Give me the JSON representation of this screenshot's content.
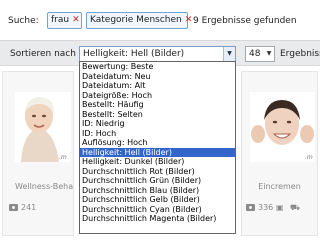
{
  "search": {
    "label": "Suche:",
    "tags": [
      {
        "text": "frau",
        "remove": "✕"
      },
      {
        "text": "Kategorie Menschen",
        "remove": "✕"
      }
    ],
    "result_count": "9 Ergebnisse gefunden"
  },
  "toolbar": {
    "sort_label": "Sortieren nach",
    "sort_value": "Helligkeit: Hell (Bilder)",
    "per_page_value": "48",
    "per_page_label": "Ergebnisse"
  },
  "sort_options": [
    "Bewertung: Beste",
    "Dateidatum: Neu",
    "Dateidatum: Alt",
    "Dateigröße: Hoch",
    "Bestellt: Häufig",
    "Bestellt: Selten",
    "ID: Niedrig",
    "ID: Hoch",
    "Auflösung: Hoch",
    "Helligkeit: Hell (Bilder)",
    "Helligkeit: Dunkel (Bilder)",
    "Durchschnittlich Rot (Bilder)",
    "Durchschnittlich Grün (Bilder)",
    "Durchschnittlich Blau (Bilder)",
    "Durchschnittlich Gelb (Bilder)",
    "Durchschnittlich Cyan (Bilder)",
    "Durchschnittlich Magenta (Bilder)"
  ],
  "selected_option_index": 9,
  "cards": [
    {
      "title": "Wellness-Beha",
      "watermark": ".m",
      "count": "241"
    },
    {
      "title": "Eincremen",
      "watermark": ".m",
      "count": "336"
    }
  ],
  "colors": {
    "selection": "#3366cc",
    "tag_border": "#6fa3d6",
    "remove_icon": "#c0282a"
  }
}
